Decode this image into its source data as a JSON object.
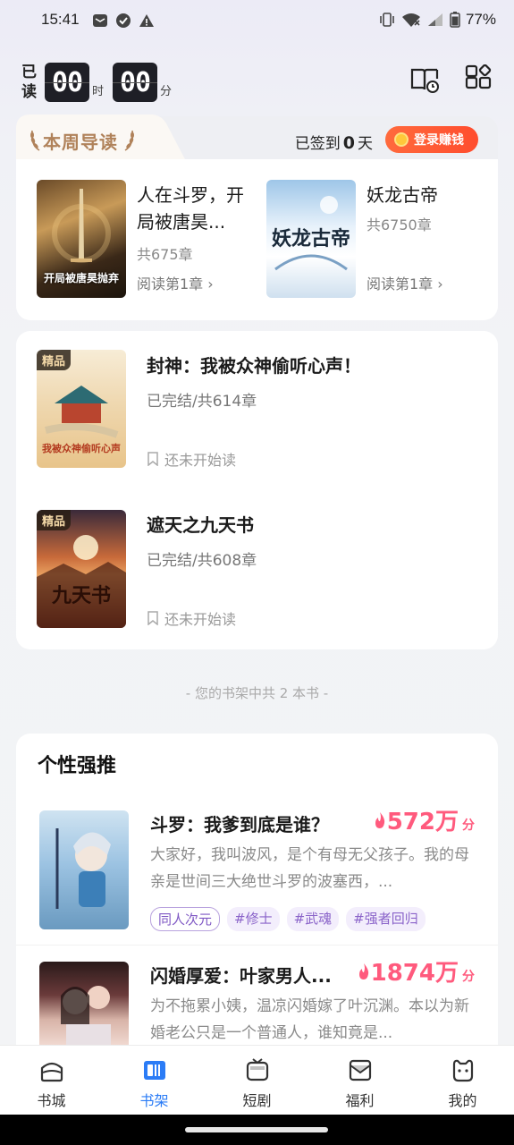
{
  "status_bar": {
    "time": "15:41",
    "battery": "77%"
  },
  "timer": {
    "label": "已读",
    "hours": "00",
    "hours_unit": "时",
    "minutes": "00",
    "minutes_unit": "分"
  },
  "guide": {
    "title": "本周导读",
    "checkin_prefix": "已签到",
    "checkin_days": "0",
    "checkin_suffix": "天",
    "earn_label": "登录赚钱",
    "books": [
      {
        "name": "人在斗罗，开局被唐昊...",
        "chapters": "共675章",
        "read": "阅读第1章",
        "cover_text": "开局被唐昊抛弃"
      },
      {
        "name": "妖龙古帝",
        "chapters": "共6750章",
        "read": "阅读第1章",
        "cover_text": "妖龙古帝"
      }
    ]
  },
  "shelf": {
    "books": [
      {
        "badge": "精品",
        "name": "封神：我被众神偷听心声！",
        "status": "已完结/共614章",
        "progress": "还未开始读",
        "cover_text": "我被众神偷听心声"
      },
      {
        "badge": "精品",
        "name": "遮天之九天书",
        "status": "已完结/共608章",
        "progress": "还未开始读",
        "cover_text": "九天书"
      }
    ],
    "footer": "- 您的书架中共 2 本书 -"
  },
  "recommend": {
    "title": "个性强推",
    "items": [
      {
        "name": "斗罗：我爹到底是谁？",
        "score": "572万",
        "score_unit": "分",
        "desc": "大家好，我叫波风，是个有母无父孩子。我的母亲是世间三大绝世斗罗的波塞西，...",
        "tags": [
          "同人次元",
          "#修士",
          "#武魂",
          "#强者回归"
        ]
      },
      {
        "name": "闪婚厚爱：叶家男人...",
        "score": "1874万",
        "score_unit": "分",
        "desc": "为不拖累小姨，温凉闪婚嫁了叶沉渊。本以为新婚老公只是一个普通人，谁知竟是...",
        "tags": []
      }
    ]
  },
  "nav": [
    {
      "label": "书城",
      "icon": "bookstore-icon"
    },
    {
      "label": "书架",
      "icon": "bookshelf-icon"
    },
    {
      "label": "短剧",
      "icon": "short-drama-icon"
    },
    {
      "label": "福利",
      "icon": "welfare-icon"
    },
    {
      "label": "我的",
      "icon": "profile-icon"
    }
  ],
  "colors": {
    "accent": "#2b7cf6",
    "score": "#ff5a7d",
    "guide_title": "#b0825a",
    "earn": "#ff5a33"
  }
}
